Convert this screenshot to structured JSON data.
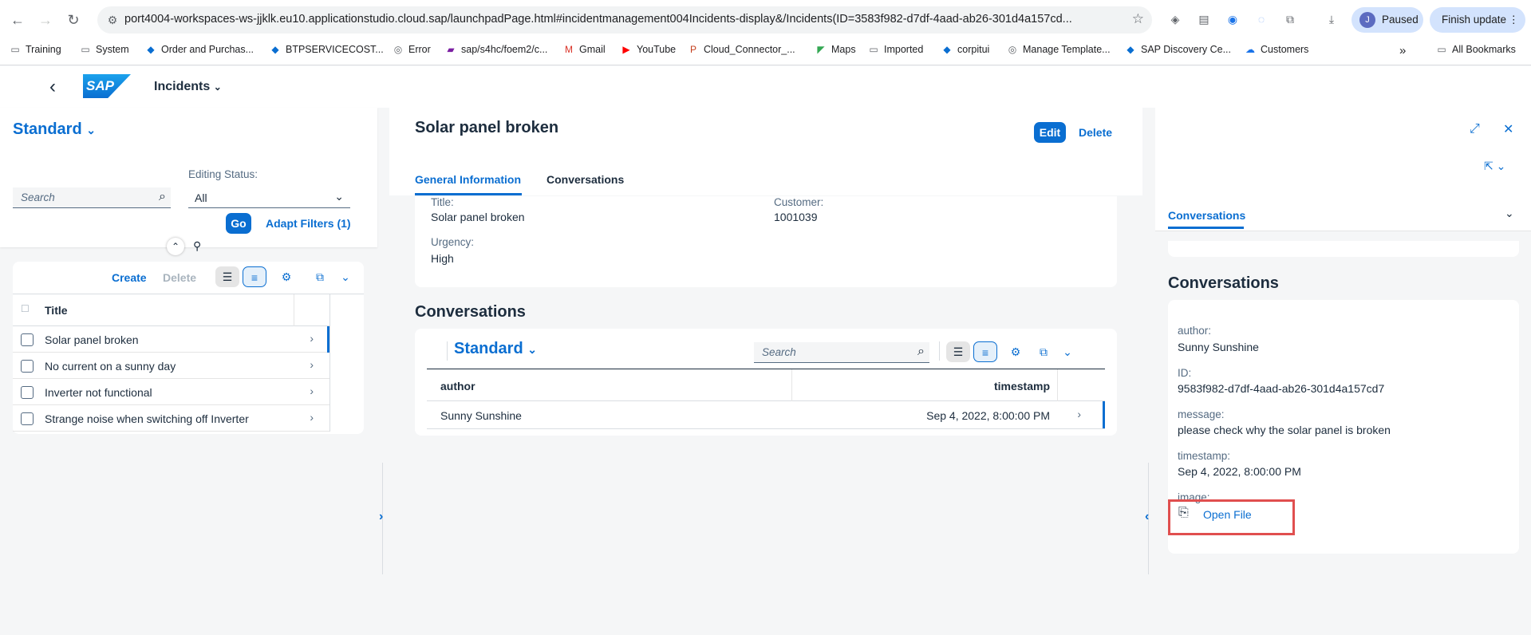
{
  "browser": {
    "url": "port4004-workspaces-ws-jjklk.eu10.applicationstudio.cloud.sap/launchpadPage.html#incidentmanagement004Incidents-display&/Incidents(ID=3583f982-d7df-4aad-ab26-301d4a157cd...",
    "profile_initial": "J",
    "profile_status": "Paused",
    "update_label": "Finish update",
    "bookmarks": [
      "Training",
      "System",
      "Order and Purchas...",
      "BTPSERVICECOST...",
      "Error",
      "sap/s4hc/foem2/c...",
      "Gmail",
      "YouTube",
      "Cloud_Connector_...",
      "Maps",
      "Imported",
      "corpitui",
      "Manage Template...",
      "SAP Discovery Ce...",
      "Customers"
    ],
    "all_bookmarks": "All Bookmarks",
    "more": "»"
  },
  "shell": {
    "logo": "SAP",
    "app_title": "Incidents",
    "back": "‹"
  },
  "list_report": {
    "variant": "Standard",
    "search_placeholder": "Search",
    "editing_status_label": "Editing Status:",
    "editing_status_value": "All",
    "go": "Go",
    "adapt_filters": "Adapt Filters (1)",
    "create": "Create",
    "delete": "Delete",
    "column_title": "Title",
    "rows": [
      "Solar panel broken",
      "No current on a sunny day",
      "Inverter not functional",
      "Strange noise when switching off Inverter"
    ]
  },
  "object_page": {
    "title": "Solar panel broken",
    "edit": "Edit",
    "delete": "Delete",
    "tabs": [
      "General Information",
      "Conversations"
    ],
    "fields": {
      "title_label": "Title:",
      "title_value": "Solar panel broken",
      "customer_label": "Customer:",
      "customer_value": "1001039",
      "urgency_label": "Urgency:",
      "urgency_value": "High"
    },
    "conversations_section": "Conversations",
    "conv_table": {
      "variant": "Standard",
      "search_placeholder": "Search",
      "col_author": "author",
      "col_timestamp": "timestamp",
      "row_author": "Sunny Sunshine",
      "row_timestamp": "Sep 4, 2022, 8:00:00 PM"
    }
  },
  "detail_pane": {
    "tab": "Conversations",
    "section_title": "Conversations",
    "author_label": "author:",
    "author_value": "Sunny Sunshine",
    "id_label": "ID:",
    "id_value": "9583f982-d7df-4aad-ab26-301d4a157cd7",
    "message_label": "message:",
    "message_value": "please check why the solar panel is broken",
    "timestamp_label": "timestamp:",
    "timestamp_value": "Sep 4, 2022, 8:00:00 PM",
    "image_label": "image:",
    "open_file": "Open File"
  },
  "colors": {
    "brand_blue": "#0a6ed1",
    "highlight_red": "#e04f4f"
  }
}
